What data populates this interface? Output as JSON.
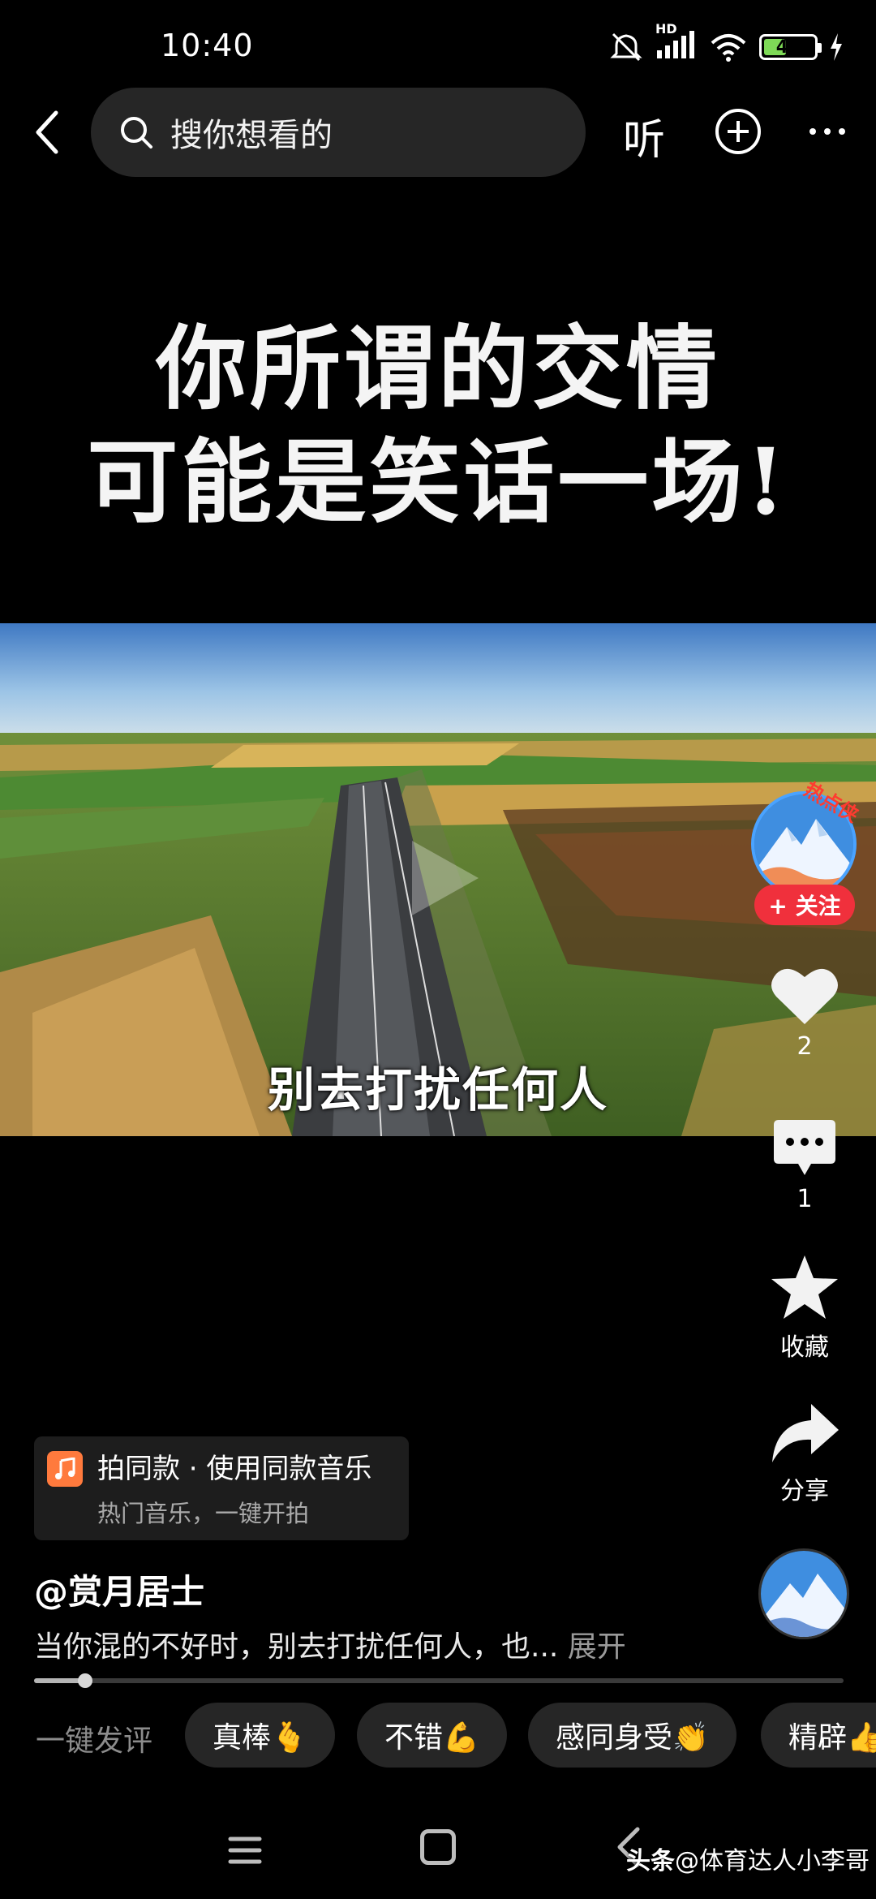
{
  "status_bar": {
    "time": "10:40",
    "network_label": "HD",
    "battery_level": "45",
    "battery_percent": 45
  },
  "top_bar": {
    "search_placeholder": "搜你想看的",
    "listen_label": "听"
  },
  "video": {
    "headline_line1": "你所谓的交情",
    "headline_line2": "可能是笑话一场!",
    "subtitle": "别去打扰任何人"
  },
  "actions": {
    "hot_badge": "热点侠",
    "follow_label": "+ 关注",
    "like_count": "2",
    "comment_count": "1",
    "favorite_label": "收藏",
    "share_label": "分享"
  },
  "same_style": {
    "title": "拍同款 · 使用同款音乐",
    "subtitle": "热门音乐，一键开拍"
  },
  "post": {
    "username": "@赏月居士",
    "description": "当你混的不好时，别去打扰任何人，也...",
    "expand_label": "展开",
    "progress_fraction": 0.063
  },
  "quick_comments": {
    "label": "一键发评",
    "chips": [
      "真棒🫰",
      "不错💪",
      "感同身受👏",
      "精辟👍"
    ]
  },
  "watermark": {
    "brand": "头条",
    "handle": "@体育达人小李哥"
  },
  "colors": {
    "follow": "#f0303c",
    "chip_bg": "#262626",
    "battery": "#7ed957"
  }
}
